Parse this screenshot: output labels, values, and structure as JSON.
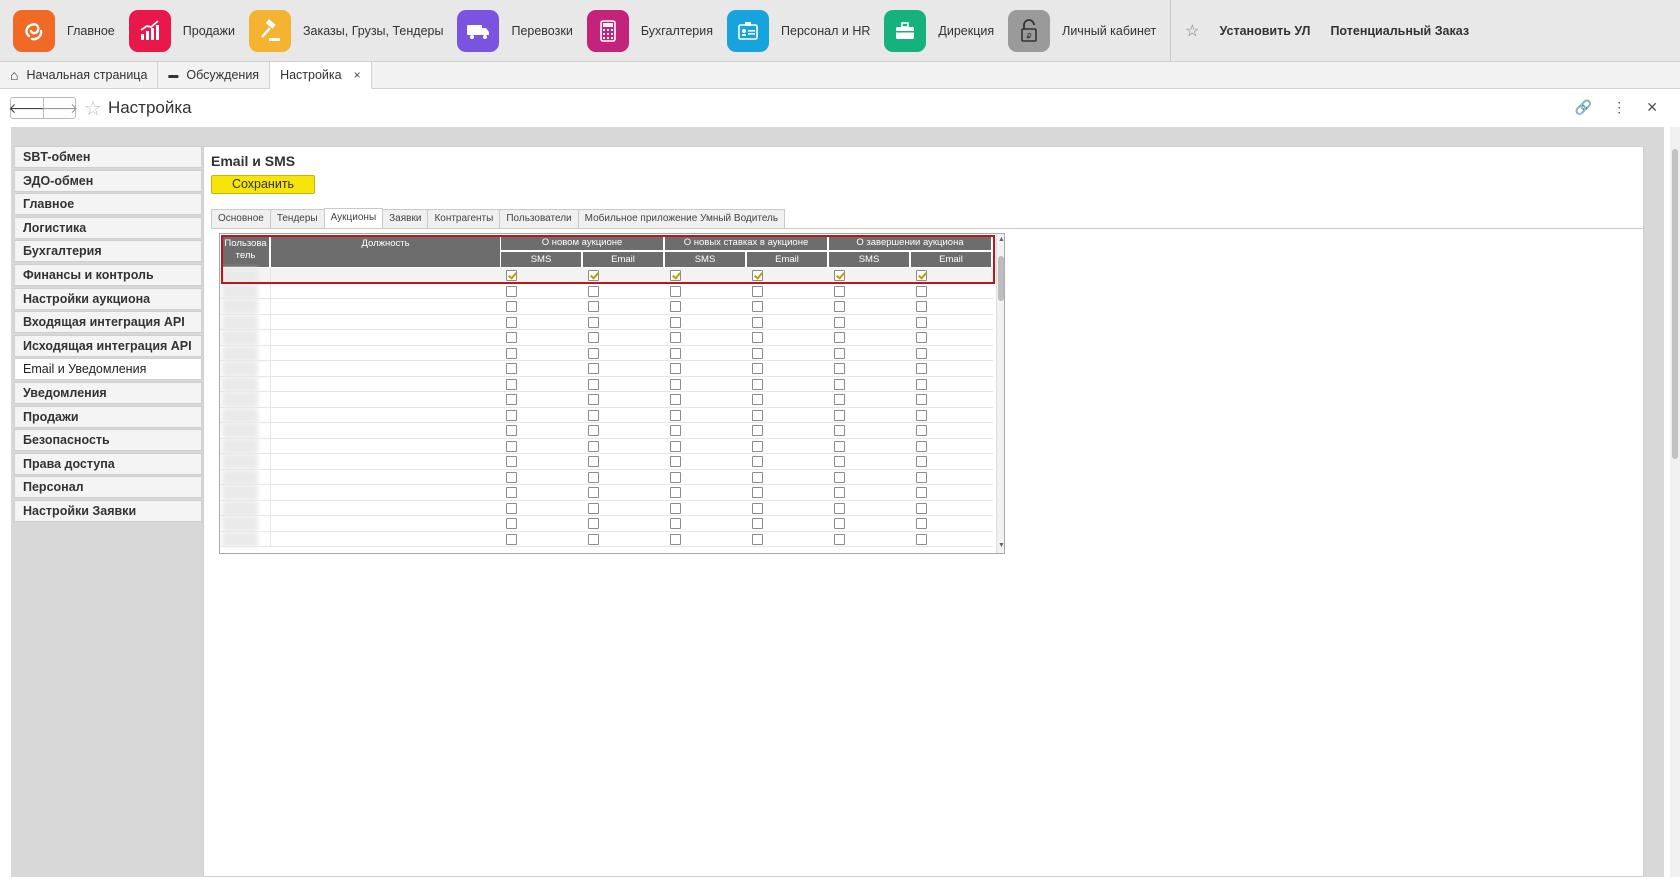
{
  "sections": [
    {
      "label": "Главное",
      "icon": "main-logo-icon",
      "color": "#f06a26"
    },
    {
      "label": "Продажи",
      "icon": "sales-chart-icon",
      "color": "#e8194a"
    },
    {
      "label": "Заказы,  Грузы, Тендеры",
      "icon": "gavel-icon",
      "color": "#f4b330"
    },
    {
      "label": "Перевозки",
      "icon": "truck-icon",
      "color": "#7a54e0"
    },
    {
      "label": "Бухгалтерия",
      "icon": "calculator-icon",
      "color": "#c3237a"
    },
    {
      "label": "Персонал и HR",
      "icon": "badge-icon",
      "color": "#16a3de"
    },
    {
      "label": "Дирекция",
      "icon": "briefcase-icon",
      "color": "#16b27e"
    },
    {
      "label": "Личный кабинет",
      "icon": "lock-ruble-icon",
      "color": "#9a9a9a"
    }
  ],
  "favorites": [
    "Установить УЛ",
    "Потенциальный Заказ"
  ],
  "open_tabs": [
    {
      "label": "Начальная страница",
      "icon": "home-icon"
    },
    {
      "label": "Обсуждения",
      "icon": "chat-icon"
    },
    {
      "label": "Настройка",
      "close": "×"
    }
  ],
  "form": {
    "title": "Настройка"
  },
  "sidebar": [
    {
      "label": "SBT-обмен"
    },
    {
      "label": "ЭДО-обмен"
    },
    {
      "label": "Главное"
    },
    {
      "label": "Логистика"
    },
    {
      "label": "Бухгалтерия"
    },
    {
      "label": "Финансы и контроль"
    },
    {
      "label": "Настройки аукциона"
    },
    {
      "label": "Входящая интеграция API"
    },
    {
      "label": "Исходящая интеграция API"
    },
    {
      "label": "Email и Уведомления",
      "active": true
    },
    {
      "label": "Уведомления"
    },
    {
      "label": "Продажи"
    },
    {
      "label": "Безопасность"
    },
    {
      "label": "Права доступа"
    },
    {
      "label": "Персонал"
    },
    {
      "label": "Настройки Заявки"
    }
  ],
  "content": {
    "title": "Email и SMS",
    "save_label": "Сохранить",
    "tabs": [
      "Основное",
      "Тендеры",
      "Аукционы",
      "Заявки",
      "Контрагенты",
      "Пользователи",
      "Мобильное приложение Умный Водитель"
    ],
    "active_tab": "Аукционы"
  },
  "table": {
    "col_user": "Пользова тель",
    "col_position": "Должность",
    "groups": [
      "О новом аукционе",
      "О новых ставках в аукционе",
      "О завершении аукциона"
    ],
    "sub": [
      "SMS",
      "Email",
      "SMS",
      "Email",
      "SMS",
      "Email"
    ],
    "first_row_checked": [
      true,
      true,
      true,
      true,
      true,
      true
    ],
    "rows_visible": 18
  }
}
